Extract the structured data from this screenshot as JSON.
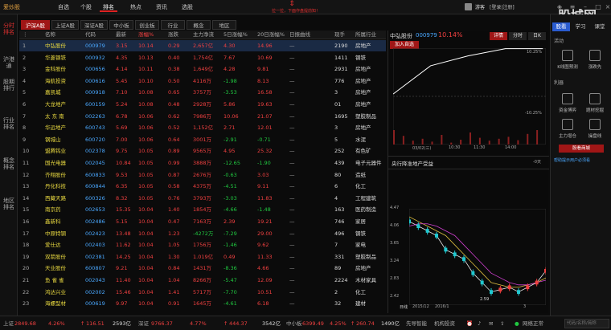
{
  "app": {
    "title": "爱炒股"
  },
  "nav": [
    "自选",
    "个股",
    "排名",
    "热点",
    "资讯",
    "选股"
  ],
  "header_tip": "拉一拉，下面作盘提前知！",
  "user": {
    "name": "游客",
    "login": "[登录|注册]"
  },
  "watermark": "股城网",
  "left_tabs": [
    "分时排名",
    "沪港通",
    "股期排行",
    "行业排名",
    "概念排名",
    "地区排名"
  ],
  "market_tabs": [
    "沪深A股",
    "上证A股",
    "深证A股",
    "中小板",
    "创业板",
    "行业",
    "概念",
    "地区"
  ],
  "columns": [
    "名称",
    "代码",
    "最新",
    "涨幅%",
    "涨跌",
    "主力净流",
    "5日涨幅%",
    "20日涨幅%",
    "日振曲线",
    "现手",
    "所属行业"
  ],
  "rows": [
    [
      "中弘股份",
      "000979",
      "3.15",
      "10.14",
      "0.29",
      "2,657亿",
      "4.30",
      "14.96",
      "—",
      "2190",
      "房地产"
    ],
    [
      "华菱钢铁",
      "000932",
      "4.35",
      "10.13",
      "0.40",
      "1,754亿",
      "7.67",
      "10.69",
      "—",
      "1411",
      "钢铁"
    ],
    [
      "金科股份",
      "000656",
      "4.14",
      "10.11",
      "0.38",
      "1,649亿",
      "4.28",
      "9.81",
      "—",
      "2931",
      "房地产"
    ],
    [
      "海航投资",
      "000616",
      "5.45",
      "10.10",
      "0.50",
      "4116万",
      "-1.98",
      "8.13",
      "—",
      "776",
      "房地产"
    ],
    [
      "嘉凯城",
      "000918",
      "7.10",
      "10.08",
      "0.65",
      "3757万",
      "-3.53",
      "16.58",
      "—",
      "3",
      "房地产"
    ],
    [
      "大龙地产",
      "600159",
      "5.24",
      "10.08",
      "0.48",
      "2928万",
      "5.86",
      "19.63",
      "—",
      "01",
      "房地产"
    ],
    [
      "太 东 南",
      "002263",
      "6.78",
      "10.06",
      "0.62",
      "7986万",
      "10.06",
      "21.07",
      "—",
      "1695",
      "塑胶制品"
    ],
    [
      "华远地产",
      "600743",
      "5.69",
      "10.06",
      "0.52",
      "1,152亿",
      "2.71",
      "12.01",
      "—",
      "3",
      "房地产"
    ],
    [
      "钢城山",
      "600720",
      "7.00",
      "10.06",
      "0.64",
      "3001万",
      "-2.91",
      "-0.71",
      "—",
      "5",
      "水泥"
    ],
    [
      "盟腾钨业",
      "002378",
      "9.75",
      "10.05",
      "0.89",
      "9565万",
      "4.95",
      "25.32",
      "—",
      "252",
      "有色矿"
    ],
    [
      "国光电器",
      "002045",
      "10.84",
      "10.05",
      "0.99",
      "3888万",
      "-12.65",
      "-1.90",
      "—",
      "439",
      "电子元器件"
    ],
    [
      "齐翔股份",
      "600833",
      "9.53",
      "10.05",
      "0.87",
      "2676万",
      "-0.63",
      "3.03",
      "—",
      "80",
      "造纸"
    ],
    [
      "丹化科技",
      "600844",
      "6.35",
      "10.05",
      "0.58",
      "4375万",
      "-4.51",
      "9.11",
      "—",
      "6",
      "化工"
    ],
    [
      "西藏天路",
      "600326",
      "8.32",
      "10.05",
      "0.76",
      "3793万",
      "-3.03",
      "11.83",
      "—",
      "4",
      "工程建筑"
    ],
    [
      "南京药",
      "002653",
      "15.35",
      "10.04",
      "1.40",
      "1854万",
      "-4.66",
      "-1.48",
      "—",
      "163",
      "医药制造"
    ],
    [
      "鑫新科",
      "002486",
      "5.15",
      "10.04",
      "0.47",
      "7163万",
      "2.39",
      "19.21",
      "—",
      "746",
      "家居"
    ],
    [
      "中原特钢",
      "002423",
      "13.48",
      "10.04",
      "1.23",
      "-4272万",
      "-7.29",
      "29.00",
      "—",
      "496",
      "钢铁"
    ],
    [
      "爱仕达",
      "002403",
      "11.62",
      "10.04",
      "1.05",
      "1756万",
      "-1.46",
      "9.62",
      "—",
      "7",
      "家电"
    ],
    [
      "双箭股份",
      "002381",
      "14.25",
      "10.04",
      "1.30",
      "1.019亿",
      "0.49",
      "11.33",
      "—",
      "331",
      "塑胶制品"
    ],
    [
      "天业股份",
      "600807",
      "9.21",
      "10.04",
      "0.84",
      "1431万",
      "-8.36",
      "4.66",
      "—",
      "89",
      "房地产"
    ],
    [
      "鱼 雀 雀",
      "002043",
      "11.40",
      "10.04",
      "1.04",
      "8266万",
      "-5.47",
      "12.09",
      "—",
      "2224",
      "木材家具"
    ],
    [
      "鸿达兴业",
      "002002",
      "15.46",
      "10.04",
      "1.41",
      "5717万",
      "-7.70",
      "10.51",
      "—",
      "2",
      "化工"
    ],
    [
      "海螺型材",
      "000619",
      "9.97",
      "10.04",
      "0.91",
      "1645万",
      "-4.61",
      "6.18",
      "—",
      "32",
      "建材"
    ]
  ],
  "chart_panel": {
    "stock_name": "中弘股份",
    "stock_code": "000979",
    "pct": "10.14%",
    "btn_add": "加入自选",
    "tabs": [
      "详情",
      "分时",
      "日K"
    ],
    "pct_top": "10.25%",
    "pct_bottom": "-10.25%",
    "time_labels": [
      "03/02(三)",
      "10:30",
      "11:30",
      "14:00"
    ],
    "section_title": "央行降准地产受益",
    "section_sub": "-0天",
    "k_y": [
      "4.47",
      "4.06",
      "3.65",
      "3.24",
      "2.83",
      "2.42"
    ],
    "k_x": [
      "日线",
      "2015/12",
      "2016/1",
      "3"
    ],
    "k_low": "2.59"
  },
  "chart_data": {
    "type": "line",
    "intraday": {
      "x": [
        "09:30",
        "10:30",
        "11:30",
        "14:00",
        "15:00"
      ],
      "values": [
        0.5,
        6.5,
        8.6,
        10.14,
        10.14
      ]
    },
    "kline": {
      "series": [
        {
          "values": [
            4.2,
            4.1,
            4.0,
            3.9,
            3.6,
            3.5,
            3.4,
            3.1,
            2.9,
            2.7,
            2.75,
            2.8,
            2.7,
            2.8,
            2.9,
            3.15
          ]
        },
        {
          "values": [
            4.3,
            4.2,
            4.1,
            4.0,
            3.9,
            3.7,
            3.5,
            3.3,
            3.1,
            2.9,
            2.85,
            2.8,
            2.8,
            2.85,
            2.9,
            3.0
          ]
        },
        {
          "values": [
            4.1,
            4.15,
            4.15,
            4.1,
            4.0,
            3.9,
            3.7,
            3.5,
            3.3,
            3.1,
            3.0,
            2.9,
            2.85,
            2.85,
            2.9,
            2.95
          ]
        }
      ]
    }
  },
  "right_panel": {
    "tabs": [
      "股看",
      "学习",
      "课堂"
    ],
    "sec1": "活动",
    "items1": [
      "K线图预测",
      "涨跌先"
    ],
    "sec2": "利器",
    "items2": [
      "资金博弈",
      "题材挖掘",
      "主力增仓",
      "操盘线"
    ],
    "btn": "股看商城",
    "link": "帮助提示用户必须看"
  },
  "status": {
    "sh_label": "上证",
    "sh_val": "2849.68",
    "sh_pct": "4.26%",
    "sh_chg": "116.51",
    "sh_vol": "2593亿",
    "sz_label": "深证",
    "sz_val": "9766.37",
    "sz_pct": "4.77%",
    "sz_chg": "444.37",
    "sz_vol": "3542亿",
    "zx_label": "中小板",
    "zx_val": "6399.49",
    "zx_pct": "4.25%",
    "zx_chg": "260.74",
    "zx_vol": "1490亿",
    "tool1": "先导智能",
    "tool2": "机构投资",
    "net": "网络正常",
    "search_placeholder": "代码/名称/简称"
  }
}
